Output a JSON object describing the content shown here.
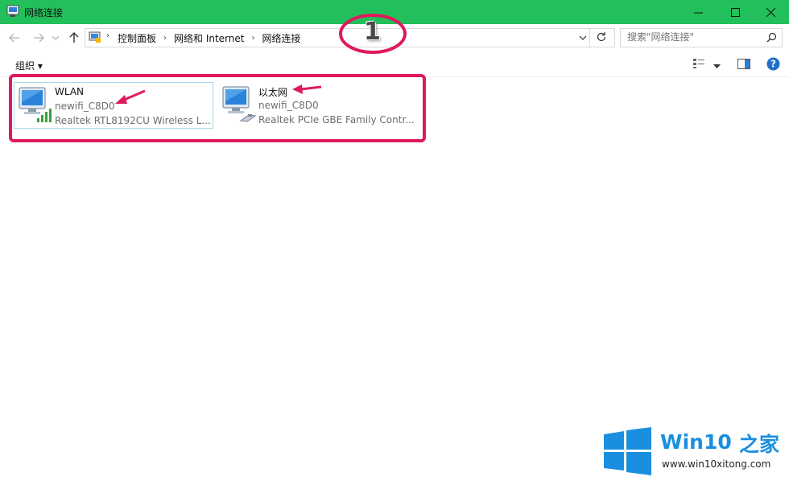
{
  "window": {
    "title": "网络连接"
  },
  "breadcrumb": {
    "items": [
      "控制面板",
      "网络和 Internet",
      "网络连接"
    ]
  },
  "search": {
    "placeholder": "搜索\"网络连接\""
  },
  "toolbar": {
    "organize_label": "组织 ▾"
  },
  "connections": [
    {
      "name": "WLAN",
      "network": "newifi_C8D0",
      "device": "Realtek RTL8192CU Wireless L...",
      "type": "wireless",
      "selected": true
    },
    {
      "name": "以太网",
      "network": "newifi_C8D0",
      "device": "Realtek PCIe GBE Family Contr...",
      "type": "ethernet",
      "selected": false
    }
  ],
  "annotation": {
    "number": "1"
  },
  "watermark": {
    "brand": "Win10",
    "brand_suffix": "之家",
    "url": "www.win10xitong.com"
  },
  "colors": {
    "titlebar": "#22c05a",
    "highlight": "#e0195d",
    "selection_border": "#a9d8ea",
    "windows_blue": "#1a8fe0"
  }
}
